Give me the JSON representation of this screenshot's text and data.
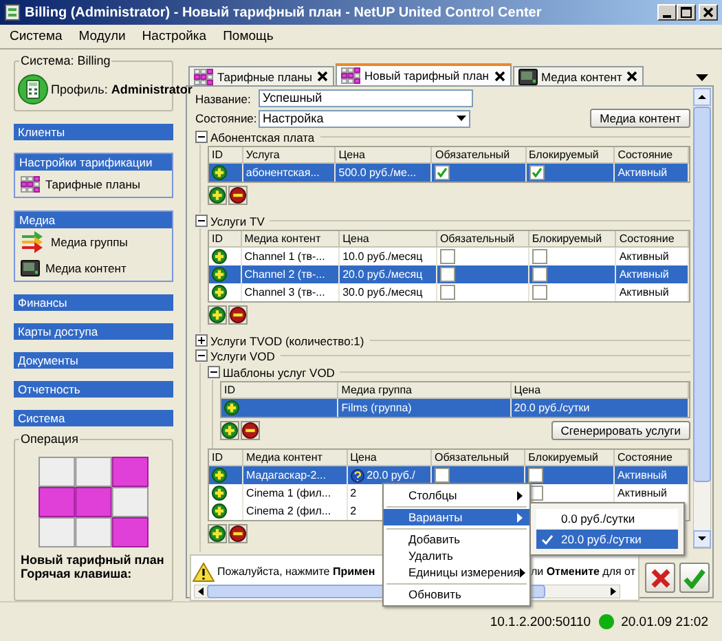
{
  "window": {
    "title": "Billing (Administrator) - Новый тарифный план - NetUP United Control Center"
  },
  "menu_bar": [
    "Система",
    "Модули",
    "Настройка",
    "Помощь"
  ],
  "sidebar": {
    "system_box": {
      "legend": "Система: Billing",
      "profile": "Профиль: **Administrator**"
    },
    "sections": [
      {
        "title": "Клиенты"
      },
      {
        "title": "Настройки тарификации",
        "items": [
          {
            "label": "Тарифные планы",
            "kind": "tariff"
          }
        ]
      },
      {
        "title": "Медиа",
        "items": [
          {
            "label": "Медиа группы",
            "kind": "groups"
          },
          {
            "label": "Медиа контент",
            "kind": "content"
          }
        ]
      },
      {
        "title": "Финансы"
      },
      {
        "title": "Карты доступа"
      },
      {
        "title": "Документы"
      },
      {
        "title": "Отчетность"
      },
      {
        "title": "Система"
      }
    ],
    "operation": {
      "legend": "Операция",
      "name": "Новый тарифный план",
      "hotkey": "Горячая клавиша:"
    }
  },
  "tabs": [
    {
      "label": "Тарифные планы",
      "kind": "tariff",
      "selected": false
    },
    {
      "label": "Новый тарифный план",
      "kind": "tariff",
      "selected": true
    },
    {
      "label": "Медиа контент",
      "kind": "content",
      "selected": false
    }
  ],
  "form": {
    "name_label": "Название:",
    "name_value": "Успешный",
    "state_label": "Состояние:",
    "state_value": "Настройка",
    "media_button": "Медиа контент"
  },
  "sections": [
    {
      "title": "Абонентская плата",
      "expanded": true,
      "blocks": [
        {
          "kind": "table",
          "columns": [
            "ID",
            "Услуга",
            "Цена",
            "Обязательный",
            "Блокируемый",
            "Состояние"
          ],
          "rows": [
            {
              "selected": true,
              "cells": [
                {
                  "kind": "add"
                },
                {
                  "kind": "text",
                  "text": "абонентская..."
                },
                {
                  "kind": "text",
                  "text": "500.0 руб./ме..."
                },
                {
                  "kind": "check",
                  "checked": true
                },
                {
                  "kind": "check",
                  "checked": true
                },
                {
                  "kind": "text",
                  "text": "Активный"
                }
              ]
            }
          ]
        }
      ]
    },
    {
      "title": "Услуги TV",
      "expanded": true,
      "blocks": [
        {
          "kind": "table",
          "columns": [
            "ID",
            "Медиа контент",
            "Цена",
            "Обязательный",
            "Блокируемый",
            "Состояние"
          ],
          "rows": [
            {
              "selected": false,
              "cells": [
                {
                  "kind": "add"
                },
                {
                  "kind": "text",
                  "text": "Channel 1 (тв-..."
                },
                {
                  "kind": "text",
                  "text": "10.0 руб./месяц"
                },
                {
                  "kind": "check",
                  "checked": false
                },
                {
                  "kind": "check",
                  "checked": false
                },
                {
                  "kind": "text",
                  "text": "Активный"
                }
              ]
            },
            {
              "selected": true,
              "cells": [
                {
                  "kind": "add"
                },
                {
                  "kind": "text",
                  "text": "Channel 2 (тв-..."
                },
                {
                  "kind": "text",
                  "text": "20.0 руб./месяц"
                },
                {
                  "kind": "check",
                  "checked": false
                },
                {
                  "kind": "check",
                  "checked": false
                },
                {
                  "kind": "text",
                  "text": "Активный"
                }
              ]
            },
            {
              "selected": false,
              "cells": [
                {
                  "kind": "add"
                },
                {
                  "kind": "text",
                  "text": "Channel 3 (тв-..."
                },
                {
                  "kind": "text",
                  "text": "30.0 руб./месяц"
                },
                {
                  "kind": "check",
                  "checked": false
                },
                {
                  "kind": "check",
                  "checked": false
                },
                {
                  "kind": "text",
                  "text": "Активный"
                }
              ]
            }
          ]
        }
      ]
    },
    {
      "title": "Услуги TVOD (количество:1)",
      "expanded": false
    },
    {
      "title": "Услуги VOD",
      "expanded": true,
      "blocks": [
        {
          "kind": "group",
          "title": "Шаблоны услуг VOD",
          "expanded": true,
          "blocks": [
            {
              "kind": "table",
              "columns": [
                "ID",
                "Медиа группа",
                "Цена"
              ],
              "action": "Сгенерировать услуги",
              "rows": [
                {
                  "selected": true,
                  "cells": [
                    {
                      "kind": "add"
                    },
                    {
                      "kind": "text",
                      "text": "Films (группа)"
                    },
                    {
                      "kind": "text",
                      "text": "20.0 руб./сутки"
                    }
                  ]
                }
              ]
            }
          ]
        },
        {
          "kind": "table",
          "columns": [
            "ID",
            "Медиа контент",
            "Цена",
            "Обязательный",
            "Блокируемый",
            "Состояние"
          ],
          "rows": [
            {
              "selected": true,
              "cells": [
                {
                  "kind": "add"
                },
                {
                  "kind": "text",
                  "text": "Мадагаскар-2..."
                },
                {
                  "kind": "price",
                  "text": "20.0 руб./"
                },
                {
                  "kind": "check",
                  "checked": false
                },
                {
                  "kind": "check",
                  "checked": false
                },
                {
                  "kind": "text",
                  "text": "Активный"
                }
              ]
            },
            {
              "selected": false,
              "cells": [
                {
                  "kind": "add"
                },
                {
                  "kind": "text",
                  "text": "Cinema 1 (фил..."
                },
                {
                  "kind": "text",
                  "text": "2"
                },
                {
                  "kind": "hidden"
                },
                {
                  "kind": "check",
                  "checked": false
                },
                {
                  "kind": "text",
                  "text": "Активный"
                }
              ]
            },
            {
              "selected": false,
              "cells": [
                {
                  "kind": "add"
                },
                {
                  "kind": "text",
                  "text": "Cinema 2 (фил..."
                },
                {
                  "kind": "text",
                  "text": "2"
                },
                {
                  "kind": "hidden"
                },
                {
                  "kind": "hidden"
                },
                {
                  "kind": "hidden"
                }
              ]
            }
          ]
        }
      ]
    }
  ],
  "message": {
    "start": "Пожалуйста, нажмите **Примен**",
    "end": "ли **Отмените** для от"
  },
  "context_menu": {
    "items": [
      {
        "label": "Столбцы",
        "kind": "submenu",
        "selected": false
      },
      {
        "kind": "separator"
      },
      {
        "label": "Варианты",
        "kind": "submenu",
        "selected": true
      },
      {
        "kind": "separator"
      },
      {
        "label": "Добавить",
        "kind": "item",
        "selected": false
      },
      {
        "label": "Удалить",
        "kind": "item",
        "selected": false
      },
      {
        "label": "Единицы измерения",
        "kind": "submenu",
        "selected": false
      },
      {
        "kind": "separator"
      },
      {
        "label": "Обновить",
        "kind": "item",
        "selected": false
      }
    ],
    "submenu": [
      {
        "label": "0.0 руб./сутки",
        "checked": false,
        "selected": false
      },
      {
        "label": "20.0 руб./сутки",
        "checked": true,
        "selected": true
      }
    ]
  },
  "status_bar": {
    "address": "10.1.2.200:50110",
    "connected": true,
    "datetime": "20.01.09 21:02"
  }
}
